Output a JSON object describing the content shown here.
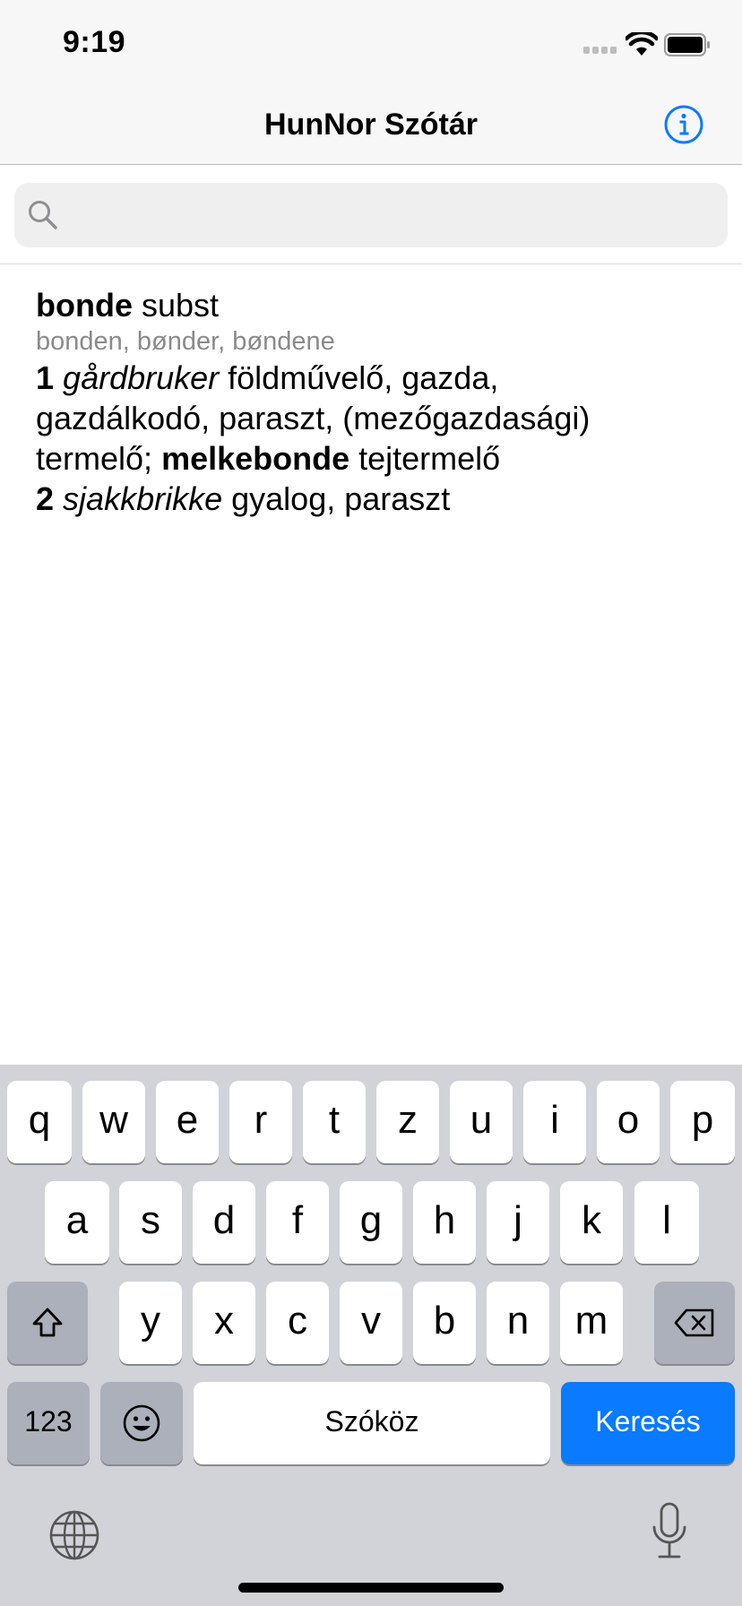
{
  "status_bar": {
    "time": "9:19"
  },
  "nav": {
    "title": "HunNor Szótár"
  },
  "search": {
    "value": "",
    "placeholder": ""
  },
  "entry": {
    "headword": "bonde",
    "pos": "subst",
    "forms": "bonden, bønder, bøndene",
    "sense1_num": "1",
    "sense1_context": "gårdbruker",
    "sense1_translation_a": "földművelő, gazda,",
    "sense1_translation_b": "gazdálkodó, paraszt, (mezőgazdasági)",
    "sense1_translation_c": "termelő;",
    "compound": "melkebonde",
    "compound_translation": "tejtermelő",
    "sense2_num": "2",
    "sense2_context": "sjakkbrikke",
    "sense2_translation": "gyalog, paraszt"
  },
  "keyboard": {
    "row1": [
      "q",
      "w",
      "e",
      "r",
      "t",
      "z",
      "u",
      "i",
      "o",
      "p"
    ],
    "row2": [
      "a",
      "s",
      "d",
      "f",
      "g",
      "h",
      "j",
      "k",
      "l"
    ],
    "row3": [
      "y",
      "x",
      "c",
      "v",
      "b",
      "n",
      "m"
    ],
    "numbers_label": "123",
    "space_label": "Szóköz",
    "return_label": "Keresés",
    "accent_color": "#0a7aff"
  }
}
